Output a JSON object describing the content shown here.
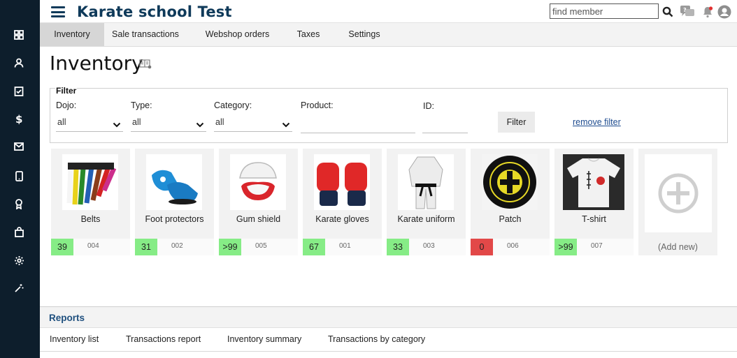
{
  "app": {
    "title": "Karate school Test"
  },
  "search": {
    "placeholder": "find member"
  },
  "sidebar": {
    "items": [
      {
        "icon": "dashboard-icon"
      },
      {
        "icon": "person-icon"
      },
      {
        "icon": "clipboard-check-icon"
      },
      {
        "icon": "dollar-icon"
      },
      {
        "icon": "mail-icon"
      },
      {
        "icon": "tablet-icon"
      },
      {
        "icon": "award-icon"
      },
      {
        "icon": "shopping-bag-icon"
      },
      {
        "icon": "gear-icon"
      },
      {
        "icon": "magic-wand-icon"
      }
    ]
  },
  "tabs": [
    {
      "label": "Inventory",
      "active": true
    },
    {
      "label": "Sale transactions"
    },
    {
      "label": "Webshop orders"
    },
    {
      "label": "Taxes"
    },
    {
      "label": "Settings"
    }
  ],
  "page": {
    "title": "Inventory"
  },
  "filter": {
    "legend": "Filter",
    "dojo": {
      "label": "Dojo:",
      "value": "all"
    },
    "type": {
      "label": "Type:",
      "value": "all"
    },
    "category": {
      "label": "Category:",
      "value": "all"
    },
    "product": {
      "label": "Product:",
      "value": ""
    },
    "id": {
      "label": "ID:",
      "value": ""
    },
    "filter_button": "Filter",
    "remove_filter": "remove filter"
  },
  "products": [
    {
      "name": "Belts",
      "stock": "39",
      "id": "004",
      "status": "ok"
    },
    {
      "name": "Foot protectors",
      "stock": "31",
      "id": "002",
      "status": "ok"
    },
    {
      "name": "Gum shield",
      "stock": ">99",
      "id": "005",
      "status": "ok"
    },
    {
      "name": "Karate gloves",
      "stock": "67",
      "id": "001",
      "status": "ok"
    },
    {
      "name": "Karate uniform",
      "stock": "33",
      "id": "003",
      "status": "ok"
    },
    {
      "name": "Patch",
      "stock": "0",
      "id": "006",
      "status": "out"
    },
    {
      "name": "T-shirt",
      "stock": ">99",
      "id": "007",
      "status": "ok"
    }
  ],
  "add_new": "(Add new)",
  "reports": {
    "title": "Reports",
    "links": [
      "Inventory list",
      "Transactions report",
      "Inventory summary",
      "Transactions by category"
    ]
  },
  "colors": {
    "sidebar": "#0d1e2c",
    "brand": "#0f3a5a",
    "in_stock": "#86ec86",
    "out_of_stock": "#e24848"
  }
}
